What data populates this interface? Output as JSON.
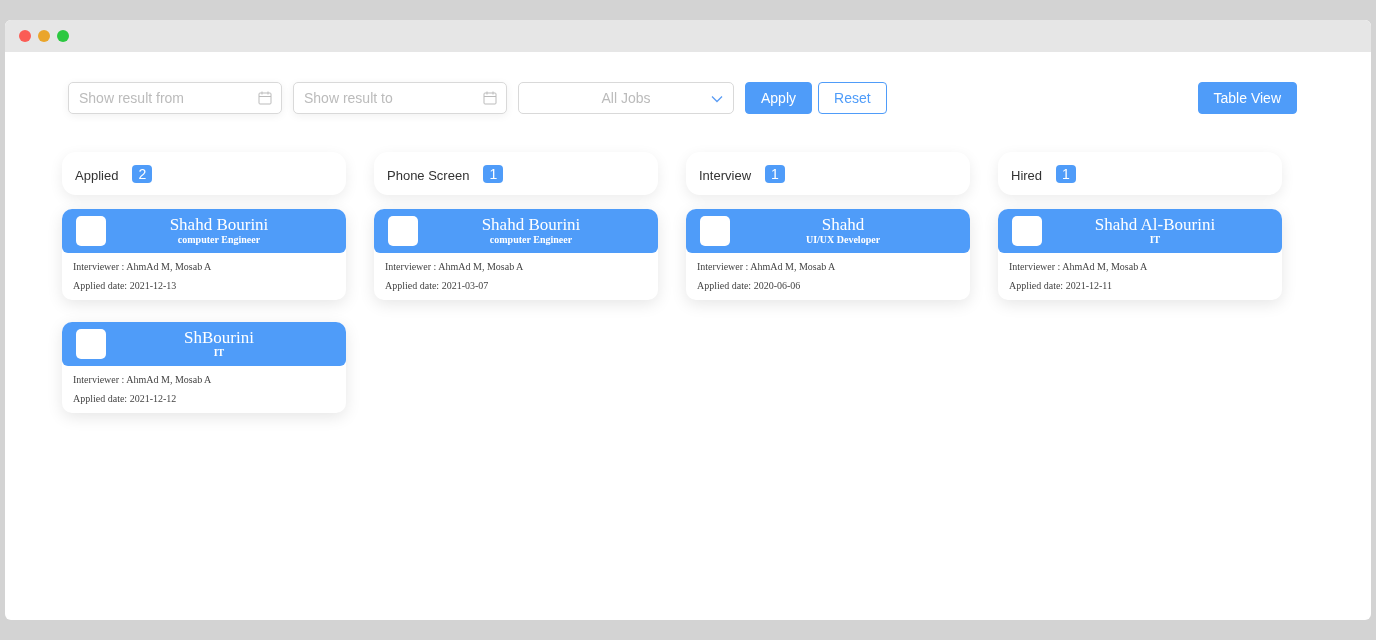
{
  "filters": {
    "date_from": {
      "placeholder": "Show result from"
    },
    "date_to": {
      "placeholder": "Show result to"
    },
    "job_select": {
      "value": "All Jobs"
    },
    "buttons": [
      {
        "label": "Apply",
        "kind": "primary"
      },
      {
        "label": "Reset",
        "kind": "outline"
      }
    ]
  },
  "view_button": {
    "label": "Table View"
  },
  "columns": [
    {
      "title": "Applied",
      "count": "2",
      "cards": [
        {
          "name": "Shahd Bourini",
          "role": "computer Engineer",
          "interviewer": "Interviewer : AhmAd M, Mosab A",
          "date": "Applied date: 2021-12-13"
        },
        {
          "name": "ShBourini",
          "role": "IT",
          "interviewer": "Interviewer : AhmAd M, Mosab A",
          "date": "Applied date: 2021-12-12"
        }
      ]
    },
    {
      "title": "Phone Screen",
      "count": "1",
      "cards": [
        {
          "name": "Shahd Bourini",
          "role": "computer Engineer",
          "interviewer": "Interviewer : AhmAd M, Mosab A",
          "date": "Applied date: 2021-03-07"
        }
      ]
    },
    {
      "title": "Interview",
      "count": "1",
      "cards": [
        {
          "name": "Shahd",
          "role": "UI/UX Developer",
          "interviewer": "Interviewer : AhmAd M, Mosab A",
          "date": "Applied date: 2020-06-06"
        }
      ]
    },
    {
      "title": "Hired",
      "count": "1",
      "cards": [
        {
          "name": "Shahd Al-Bourini",
          "role": "IT",
          "interviewer": "Interviewer : AhmAd M, Mosab A",
          "date": "Applied date: 2021-12-11"
        }
      ]
    }
  ]
}
